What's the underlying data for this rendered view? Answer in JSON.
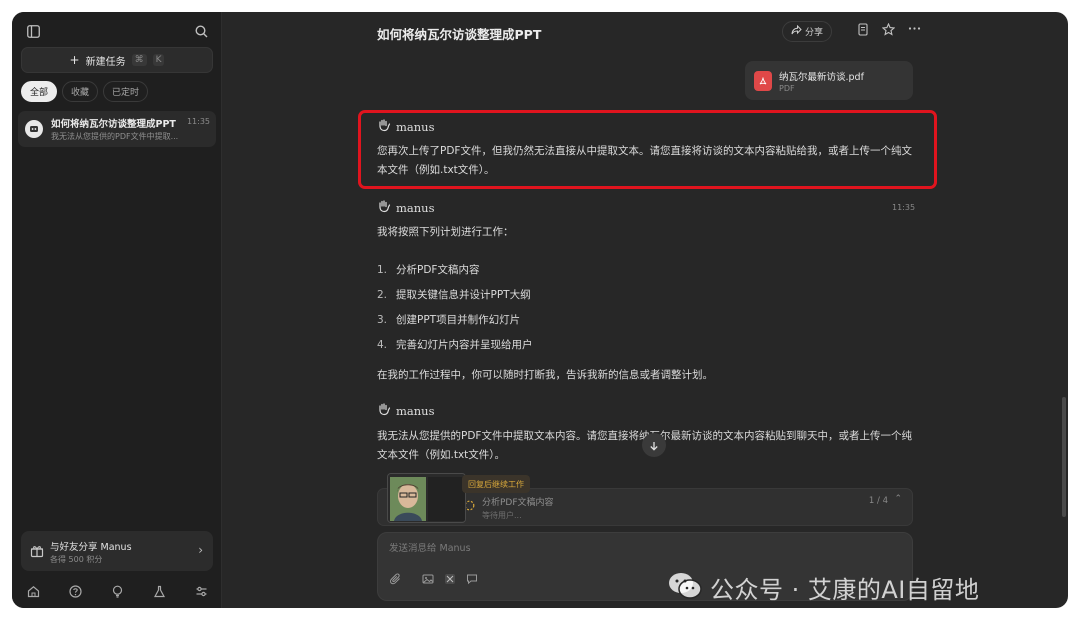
{
  "sidebar": {
    "new_task_label": "新建任务",
    "shortcut_keys": [
      "⌘",
      "K"
    ],
    "filters": [
      "全部",
      "收藏",
      "已定时"
    ],
    "tasks": [
      {
        "title": "如何将纳瓦尔访谈整理成PPT",
        "subtitle": "我无法从您提供的PDF文件中提取...",
        "time": "11:35"
      }
    ],
    "share": {
      "title": "与好友分享 Manus",
      "subtitle": "各得 500 积分"
    }
  },
  "header": {
    "title": "如何将纳瓦尔访谈整理成PPT",
    "share_label": "分享"
  },
  "attachment": {
    "filename": "纳瓦尔最新访谈.pdf",
    "type": "PDF"
  },
  "messages": [
    {
      "sender": "manus",
      "text": "您再次上传了PDF文件，但我仍然无法直接从中提取文本。请您直接将访谈的文本内容粘贴给我，或者上传一个纯文本文件（例如.txt文件）。"
    },
    {
      "sender": "manus",
      "time": "11:35",
      "intro": "我将按照下列计划进行工作：",
      "plan": [
        "分析PDF文稿内容",
        "提取关键信息并设计PPT大纲",
        "创建PPT项目并制作幻灯片",
        "完善幻灯片内容并呈现给用户"
      ],
      "outro": "在我的工作过程中，你可以随时打断我，告诉我新的信息或者调整计划。"
    },
    {
      "sender": "manus",
      "text": "我无法从您提供的PDF文件中提取文本内容。请您直接将纳瓦尔最新访谈的文本内容粘贴到聊天中，或者上传一个纯文本文件（例如.txt文件）。"
    }
  ],
  "progress": {
    "resume_tag": "回复后继续工作",
    "current_step": "分析PDF文稿内容",
    "status": "等待用户...",
    "count": "1 / 4"
  },
  "composer": {
    "placeholder": "发送消息给 Manus"
  },
  "watermark": {
    "text": "公众号 · 艾康的AI自留地"
  },
  "colors": {
    "highlight_border": "#e0141e",
    "pdf_red": "#e04848",
    "background": "#272727",
    "sidebar": "#1f1f1f"
  }
}
